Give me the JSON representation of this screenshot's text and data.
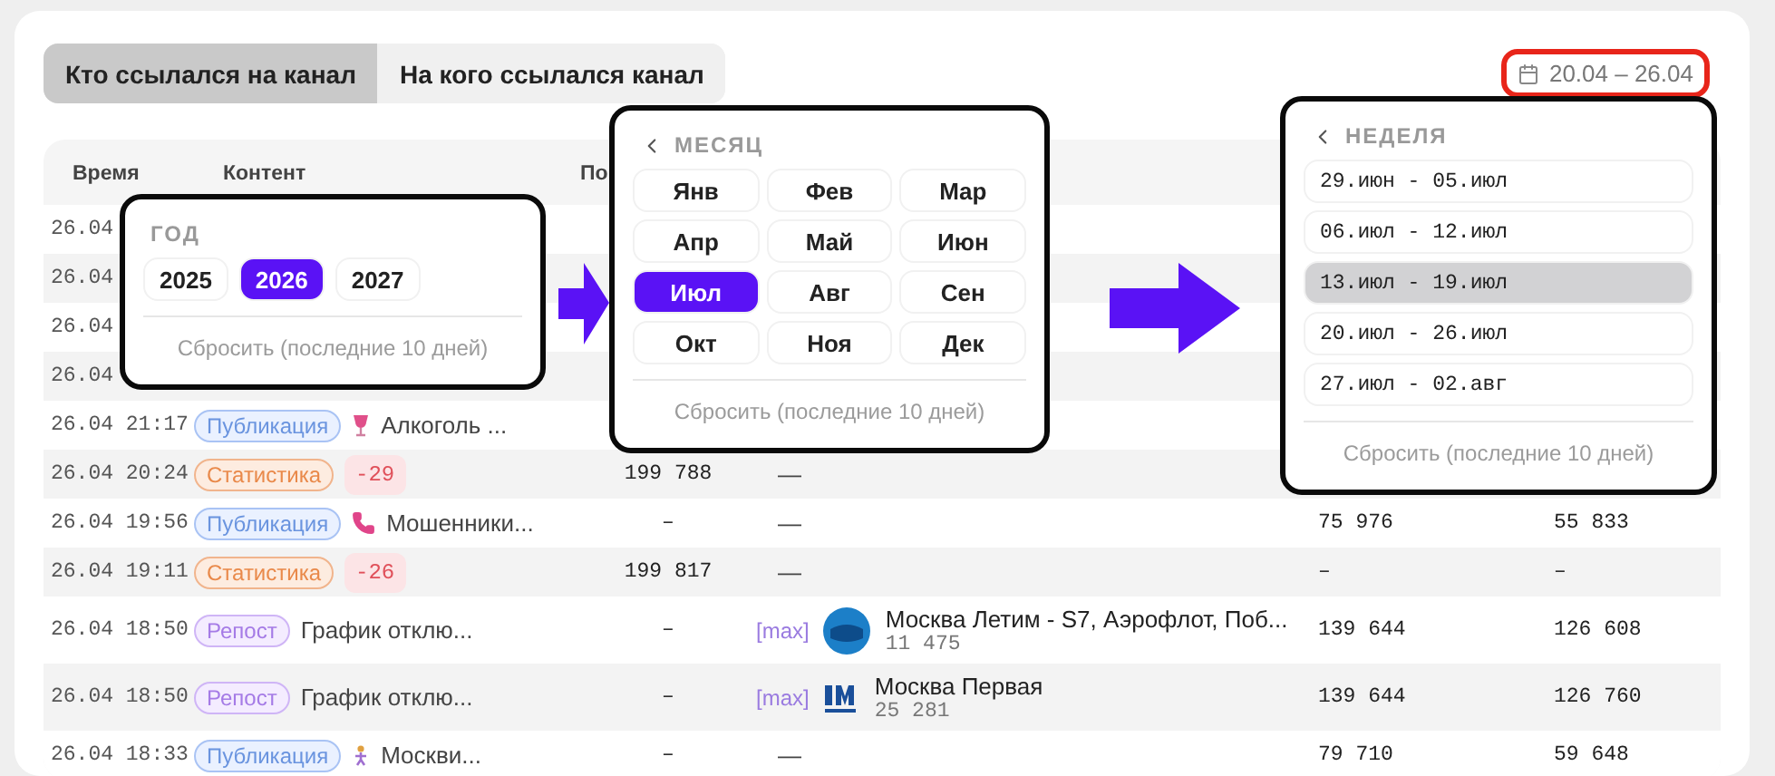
{
  "tabs": [
    {
      "label": "Кто ссылался на канал",
      "selected": true
    },
    {
      "label": "На кого ссылался канал",
      "selected": false
    }
  ],
  "date_range": {
    "label": "20.04 – 26.04",
    "highlighted": true
  },
  "table": {
    "columns": [
      "Время",
      "Контент",
      "По"
    ],
    "rows": [
      {
        "time": "26.04"
      },
      {
        "time": "26.04"
      },
      {
        "time": "26.04"
      },
      {
        "time": "26.04"
      },
      {
        "time": "26.04 21:17",
        "type": {
          "label": "Публикация",
          "kind": "post"
        },
        "content": "Алкоголь ..."
      },
      {
        "time": "26.04 20:24",
        "type": {
          "label": "Статистика",
          "kind": "stats"
        },
        "delta": "-29",
        "column_3": "199 788",
        "column_4": "—"
      },
      {
        "time": "26.04 19:56",
        "type": {
          "label": "Публикация",
          "kind": "post"
        },
        "content": "Мошенники...",
        "column_3": "–",
        "column_4": "—",
        "column_5": "75 976",
        "column_6": "55 833"
      },
      {
        "time": "26.04 19:11",
        "type": {
          "label": "Статистика",
          "kind": "stats"
        },
        "delta": "-26",
        "column_3": "199 817",
        "column_4": "—",
        "column_5": "–",
        "column_6": "–"
      },
      {
        "time": "26.04 18:50",
        "type": {
          "label": "Репост",
          "kind": "repost"
        },
        "content": "График отклю...",
        "column_3": "–",
        "channel": {
          "link": "[max]",
          "name": "Москва Летим - S7, Аэрофлот, Поб...",
          "subscribers": "11 475"
        },
        "column_5": "139 644",
        "column_6": "126 608"
      },
      {
        "time": "26.04 18:50",
        "type": {
          "label": "Репост",
          "kind": "repost"
        },
        "content": "График отклю...",
        "column_3": "–",
        "channel": {
          "link": "[max]",
          "name": "Москва Первая",
          "subscribers": "25 281"
        },
        "column_5": "139 644",
        "column_6": "126 760"
      },
      {
        "time": "26.04 18:33",
        "type": {
          "label": "Публикация",
          "kind": "post"
        },
        "content": "Москви...",
        "column_3": "–",
        "column_4": "—",
        "column_5": "79 710",
        "column_6": "59 648"
      }
    ]
  },
  "popups": [
    {
      "kind": "year",
      "back": false,
      "title": "ГОД",
      "options": [
        {
          "label": "2025",
          "selected": false
        },
        {
          "label": "2026",
          "selected": true
        },
        {
          "label": "2027",
          "selected": false
        }
      ],
      "reset": "Сбросить (последние 10 дней)"
    },
    {
      "kind": "month",
      "back": true,
      "title": "МЕСЯЦ",
      "options": [
        {
          "label": "Янв",
          "selected": false
        },
        {
          "label": "Фев",
          "selected": false
        },
        {
          "label": "Мар",
          "selected": false
        },
        {
          "label": "Апр",
          "selected": false
        },
        {
          "label": "Май",
          "selected": false
        },
        {
          "label": "Июн",
          "selected": false
        },
        {
          "label": "Июл",
          "selected": true
        },
        {
          "label": "Авг",
          "selected": false
        },
        {
          "label": "Сен",
          "selected": false
        },
        {
          "label": "Окт",
          "selected": false
        },
        {
          "label": "Ноя",
          "selected": false
        },
        {
          "label": "Дек",
          "selected": false
        }
      ],
      "reset": "Сбросить (последние 10 дней)"
    },
    {
      "kind": "week",
      "back": true,
      "title": "НЕДЕЛЯ",
      "options": [
        {
          "label": "29.июн - 05.июл",
          "selected": false
        },
        {
          "label": "06.июл - 12.июл",
          "selected": false
        },
        {
          "label": "13.июл - 19.июл",
          "selected": true
        },
        {
          "label": "20.июл - 26.июл",
          "selected": false
        },
        {
          "label": "27.июл - 02.авг",
          "selected": false
        }
      ],
      "reset": "Сбросить (последние 10 дней)"
    }
  ]
}
